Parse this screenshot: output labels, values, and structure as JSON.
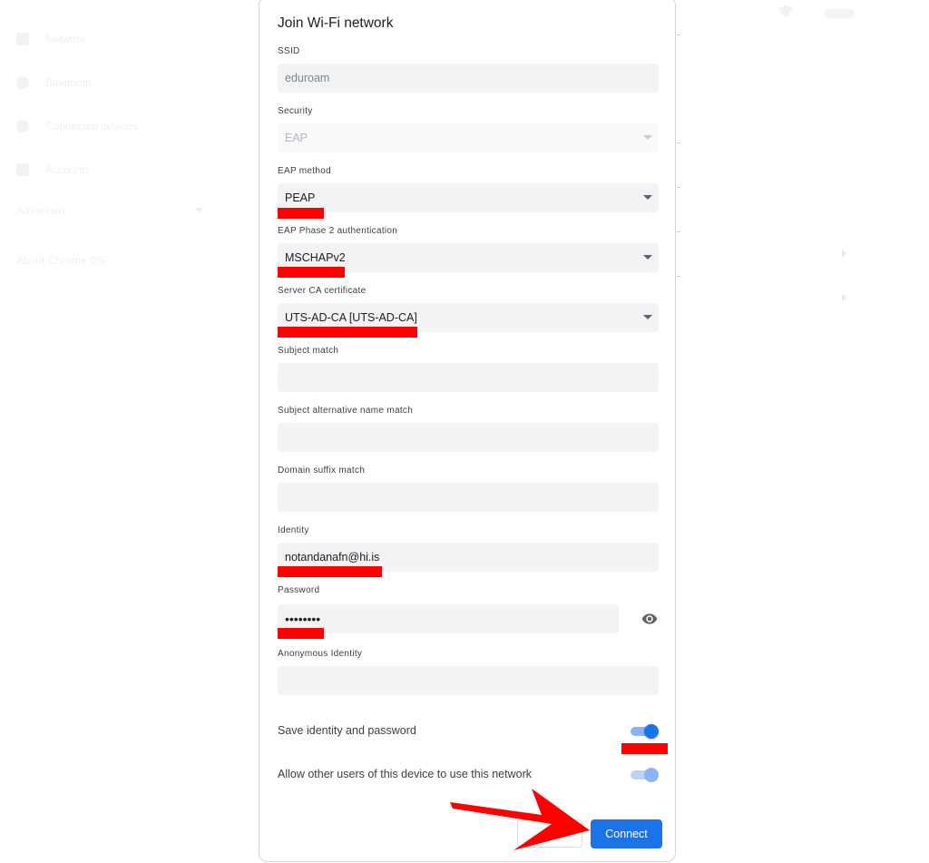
{
  "background": {
    "sidebar_items": [
      "Network",
      "Bluetooth",
      "Connected devices",
      "Accounts"
    ],
    "sidebar_section": "Advanced",
    "sidebar_footer": "About Chrome OS"
  },
  "dialog": {
    "title": "Join Wi-Fi network",
    "fields": {
      "ssid": {
        "label": "SSID",
        "value": "eduroam"
      },
      "security": {
        "label": "Security",
        "value": "EAP"
      },
      "eap_method": {
        "label": "EAP method",
        "value": "PEAP"
      },
      "phase2": {
        "label": "EAP Phase 2 authentication",
        "value": "MSCHAPv2"
      },
      "server_ca": {
        "label": "Server CA certificate",
        "value": "UTS-AD-CA [UTS-AD-CA]"
      },
      "subject_match": {
        "label": "Subject match",
        "value": ""
      },
      "subject_alt": {
        "label": "Subject alternative name match",
        "value": ""
      },
      "domain_suffix": {
        "label": "Domain suffix match",
        "value": ""
      },
      "identity": {
        "label": "Identity",
        "value": "notandanafn@hi.is"
      },
      "password": {
        "label": "Password",
        "value": "••••••••"
      },
      "anonymous": {
        "label": "Anonymous Identity",
        "value": ""
      }
    },
    "save_identity": {
      "label": "Save identity and password",
      "on": true
    },
    "share_network": {
      "label": "Allow other users of this device to use this network",
      "on": true
    },
    "connect_label": "Connect",
    "cancel_label": ""
  },
  "colors": {
    "primary": "#1a73e8",
    "annotation": "#ff0000"
  },
  "icons": {
    "password_toggle": "eye-icon",
    "dropdown": "chevron-down-icon"
  }
}
